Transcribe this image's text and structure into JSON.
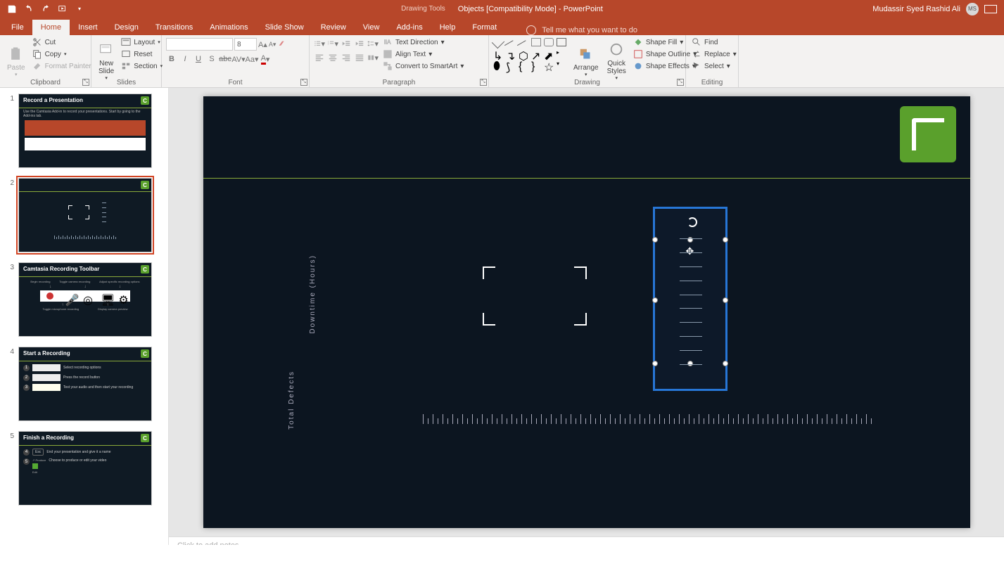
{
  "titlebar": {
    "drawing_tools": "Drawing Tools",
    "doc_title": "Objects [Compatibility Mode]  -  PowerPoint",
    "user_name": "Mudassir Syed Rashid Ali",
    "user_initials": "MS"
  },
  "tabs": {
    "file": "File",
    "home": "Home",
    "insert": "Insert",
    "design": "Design",
    "transitions": "Transitions",
    "animations": "Animations",
    "slideshow": "Slide Show",
    "review": "Review",
    "view": "View",
    "addins": "Add-ins",
    "help": "Help",
    "format": "Format",
    "tellme": "Tell me what you want to do"
  },
  "ribbon": {
    "clipboard": {
      "label": "Clipboard",
      "paste": "Paste",
      "cut": "Cut",
      "copy": "Copy",
      "format_painter": "Format Painter"
    },
    "slides": {
      "label": "Slides",
      "new_slide": "New\nSlide",
      "layout": "Layout",
      "reset": "Reset",
      "section": "Section"
    },
    "font": {
      "label": "Font",
      "size": "8"
    },
    "paragraph": {
      "label": "Paragraph",
      "text_direction": "Text Direction",
      "align_text": "Align Text",
      "convert_smartart": "Convert to SmartArt"
    },
    "drawing": {
      "label": "Drawing",
      "arrange": "Arrange",
      "quick_styles": "Quick\nStyles",
      "shape_fill": "Shape Fill",
      "shape_outline": "Shape Outline",
      "shape_effects": "Shape Effects"
    },
    "editing": {
      "label": "Editing",
      "find": "Find",
      "replace": "Replace",
      "select": "Select"
    }
  },
  "thumbs": [
    {
      "num": "1",
      "title": "Record a Presentation",
      "sub": "Use the Camtasia Add-in to record your presentations. Start by going to the Add-ins tab."
    },
    {
      "num": "2",
      "title": ""
    },
    {
      "num": "3",
      "title": "Camtasia Recording Toolbar",
      "items": [
        "Begin recording",
        "Toggle camera recording",
        "Adjust specific recording options",
        "Toggle microphone recording",
        "Display camera preview"
      ]
    },
    {
      "num": "4",
      "title": "Start a Recording",
      "steps": [
        {
          "n": "1",
          "text": "Select recording options"
        },
        {
          "n": "2",
          "text": "Press the record button"
        },
        {
          "n": "3",
          "text": "Test your audio and then start your recording"
        }
      ]
    },
    {
      "num": "5",
      "title": "Finish a Recording",
      "steps": [
        {
          "n": "4",
          "text": "End your presentation and give it a name",
          "key": "Esc"
        },
        {
          "n": "5",
          "text": "Choose to produce or edit your video",
          "key2": "Produce",
          "key3": "Edit"
        }
      ]
    }
  ],
  "slide": {
    "vlabel_top": "Downtime (Hours)",
    "vlabel_bottom": "Total Defects"
  },
  "notes": {
    "placeholder": "Click to add notes"
  }
}
